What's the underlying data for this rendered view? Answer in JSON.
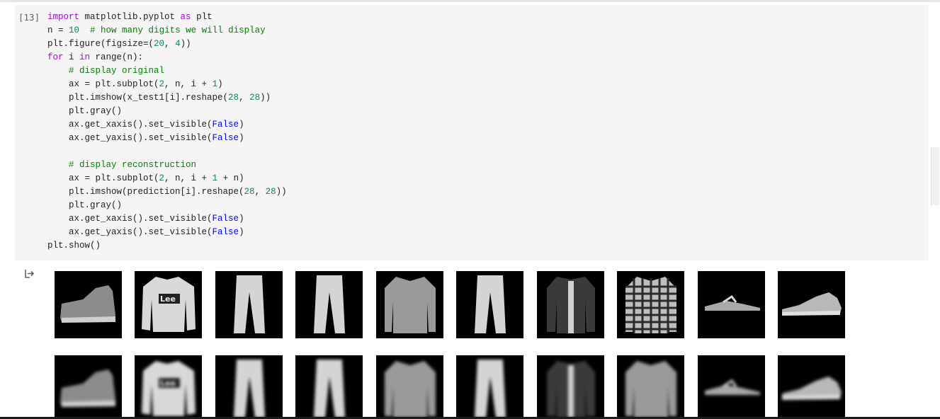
{
  "cell": {
    "execution_count": "[13]",
    "code_lines": [
      [
        {
          "t": "kw",
          "v": "import"
        },
        {
          "t": "txt",
          "v": " matplotlib.pyplot "
        },
        {
          "t": "kw",
          "v": "as"
        },
        {
          "t": "txt",
          "v": " plt"
        }
      ],
      [
        {
          "t": "txt",
          "v": "n = "
        },
        {
          "t": "num",
          "v": "10"
        },
        {
          "t": "txt",
          "v": "  "
        },
        {
          "t": "cmt",
          "v": "# how many digits we will display"
        }
      ],
      [
        {
          "t": "txt",
          "v": "plt.figure(figsize=("
        },
        {
          "t": "num",
          "v": "20"
        },
        {
          "t": "txt",
          "v": ", "
        },
        {
          "t": "num",
          "v": "4"
        },
        {
          "t": "txt",
          "v": "))"
        }
      ],
      [
        {
          "t": "kw",
          "v": "for"
        },
        {
          "t": "txt",
          "v": " i "
        },
        {
          "t": "kw",
          "v": "in"
        },
        {
          "t": "txt",
          "v": " range(n):"
        }
      ],
      [
        {
          "t": "txt",
          "v": "    "
        },
        {
          "t": "cmt",
          "v": "# display original"
        }
      ],
      [
        {
          "t": "txt",
          "v": "    ax = plt.subplot("
        },
        {
          "t": "num",
          "v": "2"
        },
        {
          "t": "txt",
          "v": ", n, i + "
        },
        {
          "t": "num",
          "v": "1"
        },
        {
          "t": "txt",
          "v": ")"
        }
      ],
      [
        {
          "t": "txt",
          "v": "    plt.imshow(x_test1[i].reshape("
        },
        {
          "t": "num",
          "v": "28"
        },
        {
          "t": "txt",
          "v": ", "
        },
        {
          "t": "num",
          "v": "28"
        },
        {
          "t": "txt",
          "v": "))"
        }
      ],
      [
        {
          "t": "txt",
          "v": "    plt.gray()"
        }
      ],
      [
        {
          "t": "txt",
          "v": "    ax.get_xaxis().set_visible("
        },
        {
          "t": "bool",
          "v": "False"
        },
        {
          "t": "txt",
          "v": ")"
        }
      ],
      [
        {
          "t": "txt",
          "v": "    ax.get_yaxis().set_visible("
        },
        {
          "t": "bool",
          "v": "False"
        },
        {
          "t": "txt",
          "v": ")"
        }
      ],
      [],
      [
        {
          "t": "txt",
          "v": "    "
        },
        {
          "t": "cmt",
          "v": "# display reconstruction"
        }
      ],
      [
        {
          "t": "txt",
          "v": "    ax = plt.subplot("
        },
        {
          "t": "num",
          "v": "2"
        },
        {
          "t": "txt",
          "v": ", n, i + "
        },
        {
          "t": "num",
          "v": "1"
        },
        {
          "t": "txt",
          "v": " + n)"
        }
      ],
      [
        {
          "t": "txt",
          "v": "    plt.imshow(prediction[i].reshape("
        },
        {
          "t": "num",
          "v": "28"
        },
        {
          "t": "txt",
          "v": ", "
        },
        {
          "t": "num",
          "v": "28"
        },
        {
          "t": "txt",
          "v": "))"
        }
      ],
      [
        {
          "t": "txt",
          "v": "    plt.gray()"
        }
      ],
      [
        {
          "t": "txt",
          "v": "    ax.get_xaxis().set_visible("
        },
        {
          "t": "bool",
          "v": "False"
        },
        {
          "t": "txt",
          "v": ")"
        }
      ],
      [
        {
          "t": "txt",
          "v": "    ax.get_yaxis().set_visible("
        },
        {
          "t": "bool",
          "v": "False"
        },
        {
          "t": "txt",
          "v": ")"
        }
      ],
      [
        {
          "t": "txt",
          "v": "plt.show()"
        }
      ]
    ]
  },
  "output": {
    "icon": "output-arrow-icon",
    "original_images": [
      "ankle-boot",
      "pullover",
      "trouser",
      "trouser",
      "shirt",
      "trouser",
      "coat",
      "shirt",
      "sandal",
      "sneaker"
    ],
    "reconstruction_images": [
      "ankle-boot",
      "pullover",
      "trouser",
      "trouser",
      "shirt",
      "trouser",
      "coat",
      "shirt",
      "sandal",
      "sneaker"
    ]
  },
  "colors": {
    "keyword": "#af00db",
    "number": "#098658",
    "comment": "#008000",
    "boolean": "#0000ff",
    "cell_background": "#f5f5f5"
  }
}
